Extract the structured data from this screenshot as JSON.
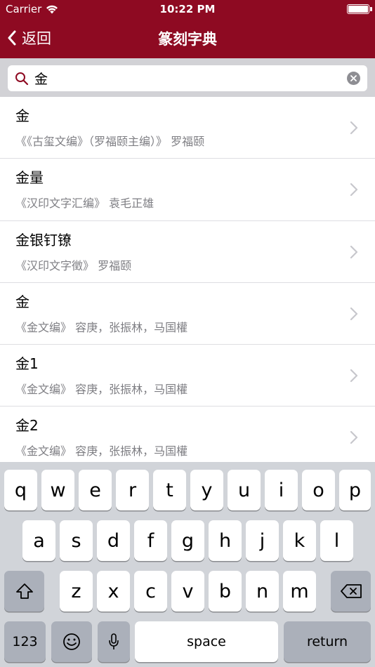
{
  "status": {
    "carrier": "Carrier",
    "time": "10:22 PM",
    "battery_level": 1.0
  },
  "nav": {
    "back_label": "返回",
    "title": "篆刻字典"
  },
  "search": {
    "value": "金",
    "placeholder": ""
  },
  "results": [
    {
      "title": "金",
      "subtitle": "《《古玺文编》（罗福颐主编）》 罗福颐"
    },
    {
      "title": "金量",
      "subtitle": "《汉印文字汇编》 袁毛正雄"
    },
    {
      "title": "金银钉镣",
      "subtitle": "《汉印文字徵》 罗福颐"
    },
    {
      "title": "金",
      "subtitle": "《金文编》 容庚，张振林，马国權"
    },
    {
      "title": "金1",
      "subtitle": "《金文编》 容庚，张振林，马国權"
    },
    {
      "title": "金2",
      "subtitle": "《金文编》 容庚，张振林，马国權"
    }
  ],
  "keyboard": {
    "row1": [
      "q",
      "w",
      "e",
      "r",
      "t",
      "y",
      "u",
      "i",
      "o",
      "p"
    ],
    "row2": [
      "a",
      "s",
      "d",
      "f",
      "g",
      "h",
      "j",
      "k",
      "l"
    ],
    "row3": [
      "z",
      "x",
      "c",
      "v",
      "b",
      "n",
      "m"
    ],
    "numbers_label": "123",
    "space_label": "space",
    "return_label": "return"
  },
  "colors": {
    "nav_bg": "#8e0a22",
    "keyboard_bg": "#d1d4d9"
  }
}
